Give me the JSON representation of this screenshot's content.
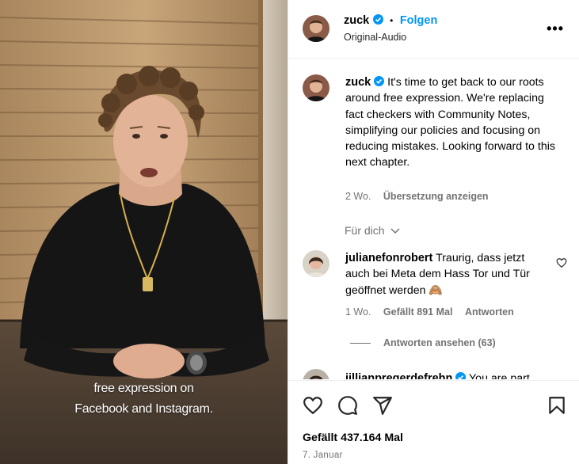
{
  "video": {
    "caption_line1": "free expression on",
    "caption_line2": "Facebook and Instagram."
  },
  "header": {
    "username": "zuck",
    "separator": "•",
    "follow_label": "Folgen",
    "audio_label": "Original-Audio",
    "more_label": "•••"
  },
  "post": {
    "username": "zuck",
    "caption": "It's time to get back to our roots around free expression. We're replacing fact checkers with Community Notes, simplifying our policies and focusing on reducing mistakes. Looking forward to this next chapter.",
    "age": "2 Wo.",
    "translate_label": "Übersetzung anzeigen",
    "filter_label": "Für dich"
  },
  "comments": [
    {
      "username": "julianefonrobert",
      "text": "Traurig, dass jetzt auch bei Meta dem Hass Tor und Tür geöffnet werden 🙈",
      "age": "1 Wo.",
      "likes": "Gefällt 891 Mal",
      "reply_label": "Antworten",
      "view_replies": "Antworten ansehen (63)"
    },
    {
      "username": "jillianpregerdefrehn",
      "text": "You are part"
    }
  ],
  "footer": {
    "likes_text": "Gefällt 437.164 Mal",
    "date": "7. Januar"
  },
  "colors": {
    "accent": "#0095f6",
    "verified": "#0095f6",
    "muted": "#737373"
  }
}
